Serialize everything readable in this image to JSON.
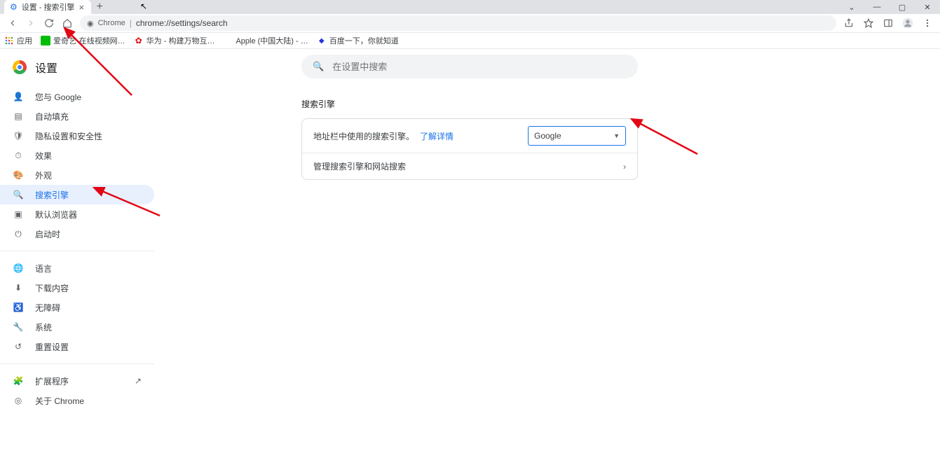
{
  "window": {
    "tab_title": "设置 - 搜索引擎",
    "min": "—",
    "chevdown": "⌄",
    "max": "▢",
    "close": "✕"
  },
  "toolbar": {
    "secure_label": "Chrome",
    "url": "chrome://settings/search"
  },
  "bookmarks": {
    "apps": "应用",
    "b1": "爱奇艺·在线视频网…",
    "b2": "华为 - 构建万物互…",
    "b3": "Apple (中国大陆) - …",
    "b4": "百度一下，你就知道"
  },
  "settings_title": "设置",
  "sidebar": {
    "items": [
      {
        "label": "您与 Google"
      },
      {
        "label": "自动填充"
      },
      {
        "label": "隐私设置和安全性"
      },
      {
        "label": "效果"
      },
      {
        "label": "外观"
      },
      {
        "label": "搜索引擎"
      },
      {
        "label": "默认浏览器"
      },
      {
        "label": "启动时"
      }
    ],
    "items2": [
      {
        "label": "语言"
      },
      {
        "label": "下载内容"
      },
      {
        "label": "无障碍"
      },
      {
        "label": "系统"
      },
      {
        "label": "重置设置"
      }
    ],
    "items3": [
      {
        "label": "扩展程序"
      },
      {
        "label": "关于 Chrome"
      }
    ]
  },
  "search_placeholder": "在设置中搜索",
  "section_title": "搜索引擎",
  "row1_text": "地址栏中使用的搜索引擎。",
  "row1_link": "了解详情",
  "row1_select": "Google",
  "row2_text": "管理搜索引擎和网站搜索"
}
